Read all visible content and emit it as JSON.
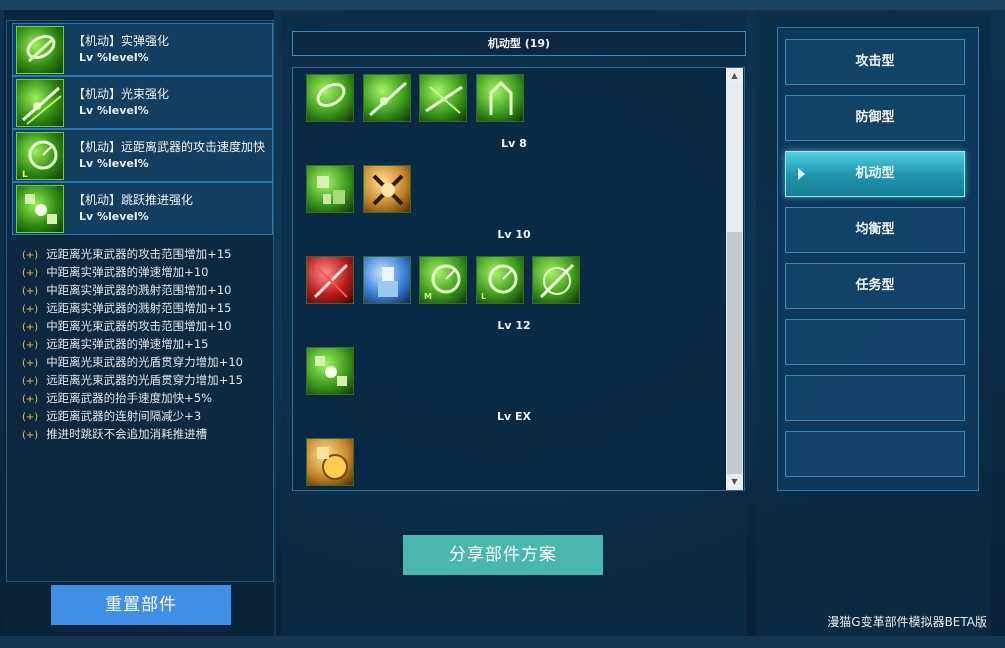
{
  "left": {
    "equipped": [
      {
        "name": "【机动】实弹强化",
        "lv": "Lv %level%",
        "icon": "bullet-boost-icon"
      },
      {
        "name": "【机动】光束强化",
        "lv": "Lv %level%",
        "icon": "beam-boost-icon"
      },
      {
        "name": "【机动】远距离武器的攻击速度加快",
        "lv": "Lv %level%",
        "icon": "gauge-icon"
      },
      {
        "name": "【机动】跳跃推进强化",
        "lv": "Lv %level%",
        "icon": "jump-thruster-icon"
      }
    ],
    "bonus_prefix": "(+)",
    "bonuses": [
      "远距离光束武器的攻击范围增加+15",
      "中距离实弹武器的弹速增加+10",
      "中距离实弹武器的溅射范围增加+10",
      "远距离实弹武器的溅射范围增加+15",
      "中距离光束武器的攻击范围增加+10",
      "远距离实弹武器的弹速增加+15",
      "中距离光束武器的光盾贯穿力增加+10",
      "远距离光束武器的光盾贯穿力增加+15",
      "远距离武器的抬手速度加快+5%",
      "远距离武器的连射间隔减少+3",
      "推进时跳跃不会追加消耗推进槽"
    ],
    "reset_label": "重置部件"
  },
  "middle": {
    "title": "机动型 (19)",
    "groups": [
      {
        "label": "",
        "icons": [
          "bullet-icon",
          "beam-icon",
          "beam-cross-icon",
          "jump-icon"
        ]
      },
      {
        "label": "Lv 8",
        "icons": [
          "mech-parts-icon",
          "gold-shield-icon"
        ]
      },
      {
        "label": "Lv 10",
        "icons": [
          "red-laser-icon",
          "blue-mech-icon",
          "gauge-m-icon",
          "gauge-l-icon",
          "crosshair-icon"
        ]
      },
      {
        "label": "Lv 12",
        "icons": [
          "boxes-icon"
        ]
      },
      {
        "label": "Lv EX",
        "icons": [
          "gold-coin-icon"
        ]
      }
    ],
    "share_label": "分享部件方案"
  },
  "right": {
    "types": [
      "攻击型",
      "防御型",
      "机动型",
      "均衡型",
      "任务型",
      "",
      "",
      ""
    ],
    "active_type": "机动型",
    "footer": "漫猫G变革部件模拟器BETA版"
  },
  "colors": {
    "accent_blue": "#3f8fe7",
    "accent_teal": "#49b7b0",
    "active_tab": "#2fb3c8"
  }
}
